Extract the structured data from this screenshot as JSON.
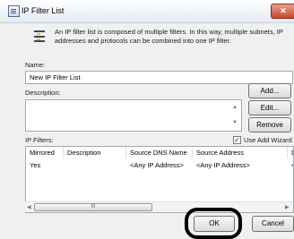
{
  "window": {
    "title": "IP Filter List",
    "close_label": "✕"
  },
  "info": {
    "text": "An IP filter list is composed of multiple filters. In this way, multiple subnets, IP addresses and protocols can be combined into one IP filter."
  },
  "name": {
    "label": "Name:",
    "value": "New IP Filter List"
  },
  "description": {
    "label": "Description:",
    "value": ""
  },
  "buttons": {
    "add": "Add...",
    "edit": "Edit...",
    "remove": "Remove",
    "ok": "OK",
    "cancel": "Cancel"
  },
  "ip_filters": {
    "label": "IP Filters:",
    "use_add_wizard": {
      "label": "Use Add Wizard",
      "checked": true
    },
    "columns": [
      "Mirrored",
      "Description",
      "Source DNS Name",
      "Source Address",
      "D"
    ],
    "rows": [
      {
        "mirrored": "Yes",
        "description": "",
        "source_dns_name": "<Any IP Address>",
        "source_address": "<Any IP Address>",
        "d": "<"
      }
    ]
  },
  "scrollbar": {
    "thumb_grip": "III"
  }
}
